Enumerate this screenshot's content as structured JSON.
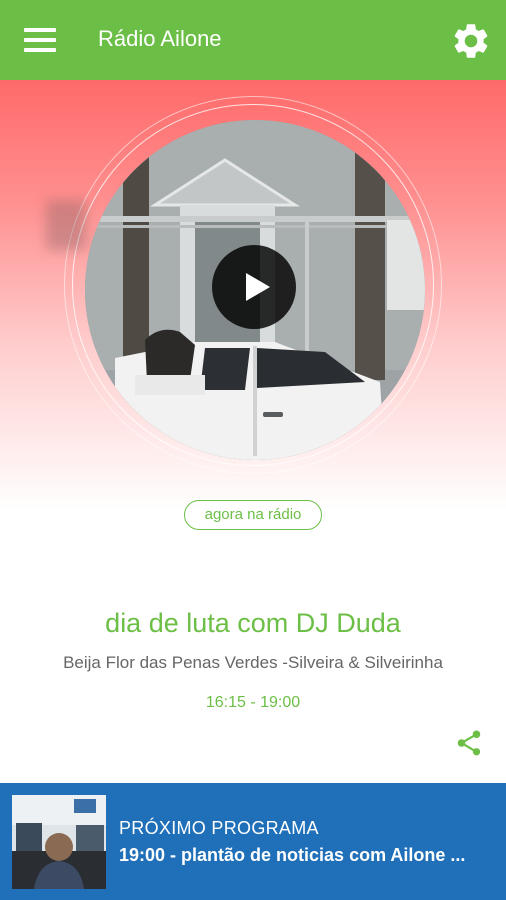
{
  "header": {
    "title": "Rádio Ailone",
    "menu_icon": "menu-icon",
    "settings_icon": "gear-icon",
    "color": "#6cbf46"
  },
  "player": {
    "badge": "agora na rádio",
    "play_icon": "play-icon",
    "gradient_top": "#ff6a6a"
  },
  "now_playing": {
    "show_title": "dia de luta com DJ Duda",
    "song": "Beija Flor das Penas Verdes -Silveira & Silveirinha",
    "schedule": "16:15 - 19:00",
    "share_icon": "share-icon"
  },
  "next_program": {
    "label": "PRÓXIMO PROGRAMA",
    "title": "19:00 - plantão de noticias com Ailone ...",
    "background": "#1f70b8"
  }
}
